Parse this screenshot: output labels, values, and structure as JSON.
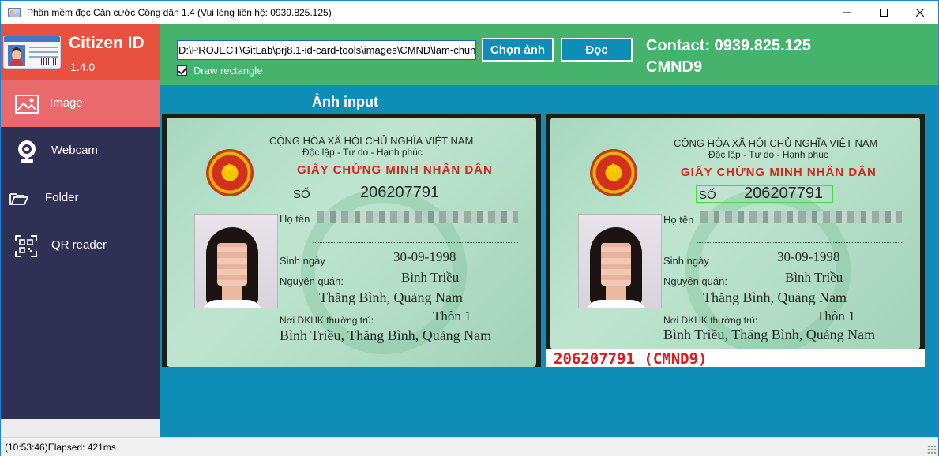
{
  "window": {
    "title": "Phần mềm đọc Căn cước Công dân 1.4  (Vui lòng liên hệ: 0939.825.125)"
  },
  "sidebar": {
    "app_name": "Citizen ID",
    "version": "1.4.0",
    "items": [
      {
        "label": "Image",
        "icon": "image-icon",
        "active": true
      },
      {
        "label": "Webcam",
        "icon": "webcam-icon",
        "active": false
      },
      {
        "label": "Folder",
        "icon": "folder-icon",
        "active": false
      },
      {
        "label": "QR reader",
        "icon": "qr-code-icon",
        "active": false
      }
    ]
  },
  "toolbar": {
    "path_value": "D:\\PROJECT\\GitLab\\prj8.1-id-card-tools\\images\\CMND\\lam-chun",
    "draw_rectangle_label": "Draw rectangle",
    "draw_rectangle_checked": true,
    "choose_image_label": "Chọn ảnh",
    "read_label": "Đọc",
    "contact": "Contact: 0939.825.125",
    "card_type": "CMND9"
  },
  "main": {
    "input_title": "Ảnh input"
  },
  "card": {
    "country_line": "CỘNG HÒA XÃ HỘI CHỦ NGHĨA VIỆT NAM",
    "motto": "Độc lập - Tự do - Hạnh phúc",
    "card_title": "GIẤY CHỨNG MINH NHÂN DÂN",
    "number_label": "SỐ",
    "number": "206207791",
    "name_label": "Họ tên",
    "dob_label": "Sinh ngày",
    "dob": "30-09-1998",
    "origin_label": "Nguyên quán:",
    "origin_line1": "Bình Triều",
    "origin_line2": "Thăng Bình, Quảng Nam",
    "residence_label": "Nơi ĐKHK thường trú:",
    "residence_line1": "Thôn 1",
    "residence_line2": "Bình Triều, Thăng Bình, Quảng Nam"
  },
  "result": {
    "text": "206207791 (CMND9)"
  },
  "status": {
    "text": "(10:53:46)Elapsed: 421ms"
  },
  "colors": {
    "sidebar_bg": "#2f3154",
    "brand_bg": "#e8513f",
    "active_item_bg": "#e86a6c",
    "toolbar_bg": "#45b36b",
    "content_bg": "#0e8db6",
    "result_text": "#e0191a",
    "detect_box": "#3ee03e"
  }
}
